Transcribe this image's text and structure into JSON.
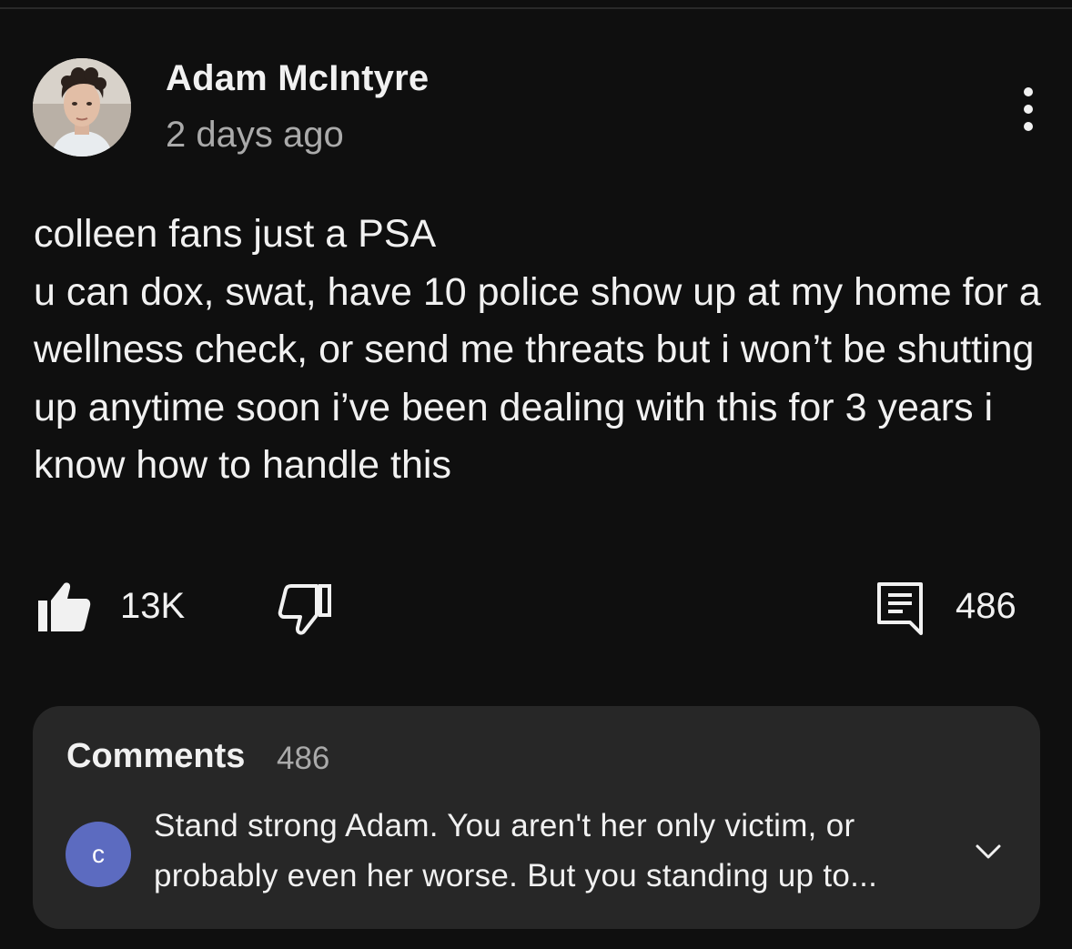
{
  "post": {
    "author": "Adam McIntyre",
    "timestamp": "2 days ago",
    "body_lines": [
      "colleen fans just a PSA",
      "u can dox, swat, have 10 police show up at my home for a wellness check, or send me threats but i won’t be shutting up anytime soon i’ve been dealing with this for 3 years i know how to handle this"
    ],
    "like_count": "13K",
    "comment_count": "486"
  },
  "comments": {
    "heading": "Comments",
    "count": "486",
    "top_comment": {
      "avatar_letter": "c",
      "text": "Stand strong Adam. You aren't her only victim, or probably even her worse. But you standing up to..."
    }
  },
  "icons": {
    "more": "more-vertical-icon",
    "like": "thumbs-up-filled-icon",
    "dislike": "thumbs-down-outline-icon",
    "comments": "comment-icon",
    "expand": "chevron-down-icon"
  },
  "colors": {
    "background": "#0f0f0f",
    "card": "#272727",
    "text_primary": "#f1f1f1",
    "text_secondary": "#aaaaaa",
    "commenter_avatar": "#5c6bc0"
  }
}
